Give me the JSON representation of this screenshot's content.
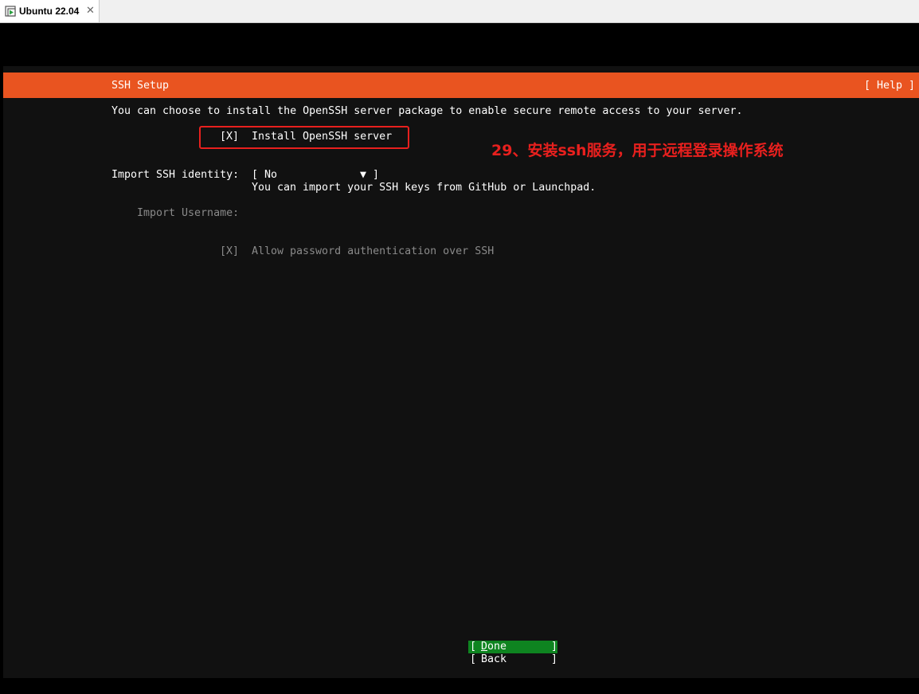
{
  "browser_tab": {
    "label": "Ubuntu 22.04",
    "close_glyph": "✕",
    "icon": "vm-play-icon"
  },
  "header": {
    "title": "SSH Setup",
    "help": "[ Help ]"
  },
  "intro_text": "You can choose to install the OpenSSH server package to enable secure remote access to your server.",
  "install_openssh": {
    "checkbox": "[X]",
    "label": "Install OpenSSH server",
    "checked": true
  },
  "annotation": "29、安装ssh服务，用于远程登录操作系统",
  "import_identity": {
    "label": "Import SSH identity:",
    "select_open": "[",
    "select_value": "No",
    "select_arrow": "▼",
    "select_close": "]",
    "help_text": "You can import your SSH keys from GitHub or Launchpad."
  },
  "import_username": {
    "label": "Import Username:"
  },
  "allow_password": {
    "checkbox": "[X]",
    "label": "Allow password authentication over SSH",
    "checked": true
  },
  "buttons": {
    "done": {
      "open": "[",
      "first": "D",
      "rest": "one",
      "close": "]"
    },
    "back": {
      "open": "[",
      "label": "Back",
      "close": "]"
    }
  },
  "colors": {
    "ubuntu_orange": "#e95420",
    "done_green": "#0e8420",
    "annotation_red": "#e8201e",
    "background": "#111111"
  }
}
